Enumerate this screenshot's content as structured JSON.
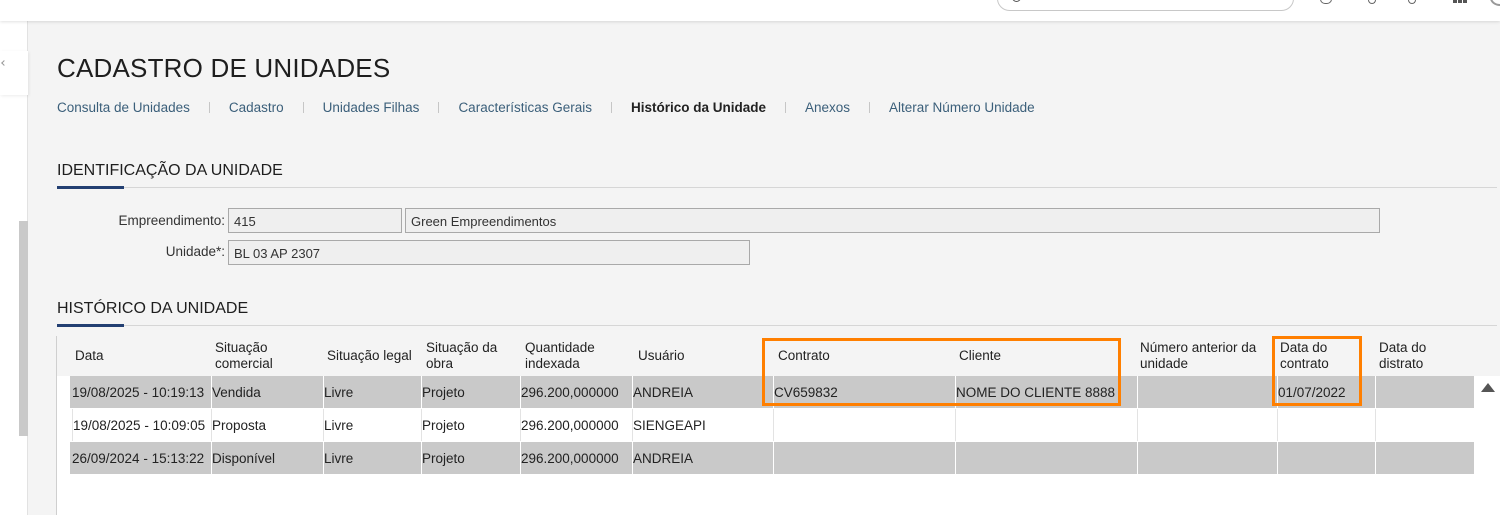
{
  "page": {
    "title": "CADASTRO DE UNIDADES",
    "tabs": [
      {
        "label": "Consulta de Unidades"
      },
      {
        "label": "Cadastro"
      },
      {
        "label": "Unidades Filhas"
      },
      {
        "label": "Características Gerais"
      },
      {
        "label": "Histórico da Unidade"
      },
      {
        "label": "Anexos"
      },
      {
        "label": "Alterar Número Unidade"
      }
    ],
    "active_tab": "Histórico da Unidade"
  },
  "identificacao": {
    "title": "IDENTIFICAÇÃO DA UNIDADE",
    "empreendimento_label": "Empreendimento:",
    "empreendimento_code": "415",
    "empreendimento_name": "Green Empreendimentos",
    "unidade_label": "Unidade*:",
    "unidade_value": "BL 03 AP  2307"
  },
  "historico": {
    "title": "HISTÓRICO DA UNIDADE",
    "columns": {
      "data": "Data",
      "situacao_comercial": "Situação comercial",
      "situacao_legal": "Situação legal",
      "situacao_obra": "Situação da obra",
      "quantidade": "Quantidade indexada",
      "usuario": "Usuário",
      "contrato": "Contrato",
      "cliente": "Cliente",
      "numero_anterior": "Número anterior da unidade",
      "data_contrato": "Data do contrato",
      "data_distrato": "Data do distrato"
    },
    "rows": [
      {
        "data": "19/08/2025 -  10:19:13",
        "situacao_comercial": "Vendida",
        "situacao_legal": "Livre",
        "situacao_obra": "Projeto",
        "quantidade": "296.200,000000",
        "usuario": "ANDREIA",
        "contrato": "CV659832",
        "cliente": "NOME DO CLIENTE 8888",
        "numero_anterior": "",
        "data_contrato": "01/07/2022",
        "data_distrato": ""
      },
      {
        "data": "19/08/2025 -  10:09:05",
        "situacao_comercial": "Proposta",
        "situacao_legal": "Livre",
        "situacao_obra": "Projeto",
        "quantidade": "296.200,000000",
        "usuario": "SIENGEAPI",
        "contrato": "",
        "cliente": "",
        "numero_anterior": "",
        "data_contrato": "",
        "data_distrato": ""
      },
      {
        "data": "26/09/2024 -  15:13:22",
        "situacao_comercial": "Disponível",
        "situacao_legal": "Livre",
        "situacao_obra": "Projeto",
        "quantidade": "296.200,000000",
        "usuario": "ANDREIA",
        "contrato": "",
        "cliente": "",
        "numero_anterior": "",
        "data_contrato": "",
        "data_distrato": ""
      }
    ]
  },
  "highlight_color": "#ff7f00"
}
